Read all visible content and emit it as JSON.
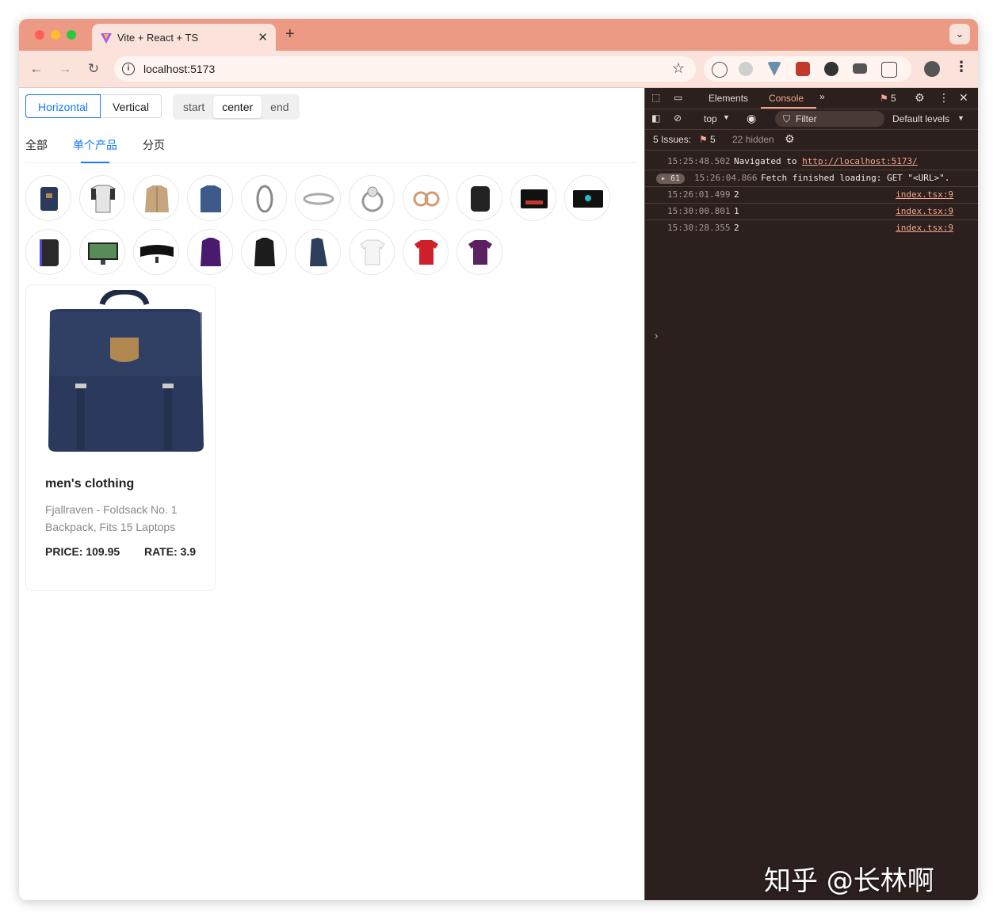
{
  "browser": {
    "tab_title": "Vite + React + TS",
    "url": "localhost:5173",
    "new_tab_label": "+"
  },
  "page": {
    "direction": {
      "horizontal_label": "Horizontal",
      "vertical_label": "Vertical",
      "selected": "Horizontal"
    },
    "align": {
      "options": [
        "start",
        "center",
        "end"
      ],
      "selected": "center"
    },
    "tabs": [
      {
        "label": "全部"
      },
      {
        "label": "单个产品",
        "active": true
      },
      {
        "label": "分页"
      }
    ],
    "product_thumbnails": [
      "backpack",
      "raglan-shirt",
      "jacket",
      "slim-shirt",
      "bracelet",
      "silver-ring",
      "diamond-ring",
      "gold-earrings",
      "hard-drive",
      "sandisk-ssd",
      "silicon-power-ssd",
      "gaming-drive",
      "acer-monitor",
      "samsung-monitor",
      "snowboard-jacket",
      "leather-jacket",
      "rain-jacket",
      "white-tee",
      "red-tee",
      "purple-tee"
    ],
    "card": {
      "category": "men's clothing",
      "title": "Fjallraven - Foldsack No. 1 Backpack, Fits 15 Laptops",
      "price_label": "PRICE: 109.95",
      "rate_label": "RATE: 3.9"
    }
  },
  "devtools": {
    "tabs": [
      "Elements",
      "Console"
    ],
    "active_tab": "Console",
    "issues_count": "5",
    "context": "top",
    "filter_placeholder": "Filter",
    "levels": "Default levels",
    "issues_label": "5 Issues:",
    "issues_badge": "5",
    "hidden_label": "22 hidden",
    "logs": [
      {
        "ts": "15:25:48.502",
        "msg_prefix": "Navigated to ",
        "link": "http://localhost:5173/"
      },
      {
        "count": "61",
        "ts": "15:26:04.866",
        "msg": "Fetch finished loading: GET \"<URL>\"."
      },
      {
        "ts": "15:26:01.499",
        "msg": "2",
        "src": "index.tsx:9"
      },
      {
        "ts": "15:30:00.801",
        "msg": "1",
        "src": "index.tsx:9"
      },
      {
        "ts": "15:30:28.355",
        "msg": "2",
        "src": "index.tsx:9"
      }
    ]
  },
  "watermark": "知乎 @长林啊",
  "colors": {
    "accent": "#1677ff",
    "chrome_tabstrip": "#ec9a83",
    "chrome_toolbar": "#fbe3dc",
    "devtools_bg": "#2b201d",
    "devtools_accent": "#f4a58c"
  }
}
